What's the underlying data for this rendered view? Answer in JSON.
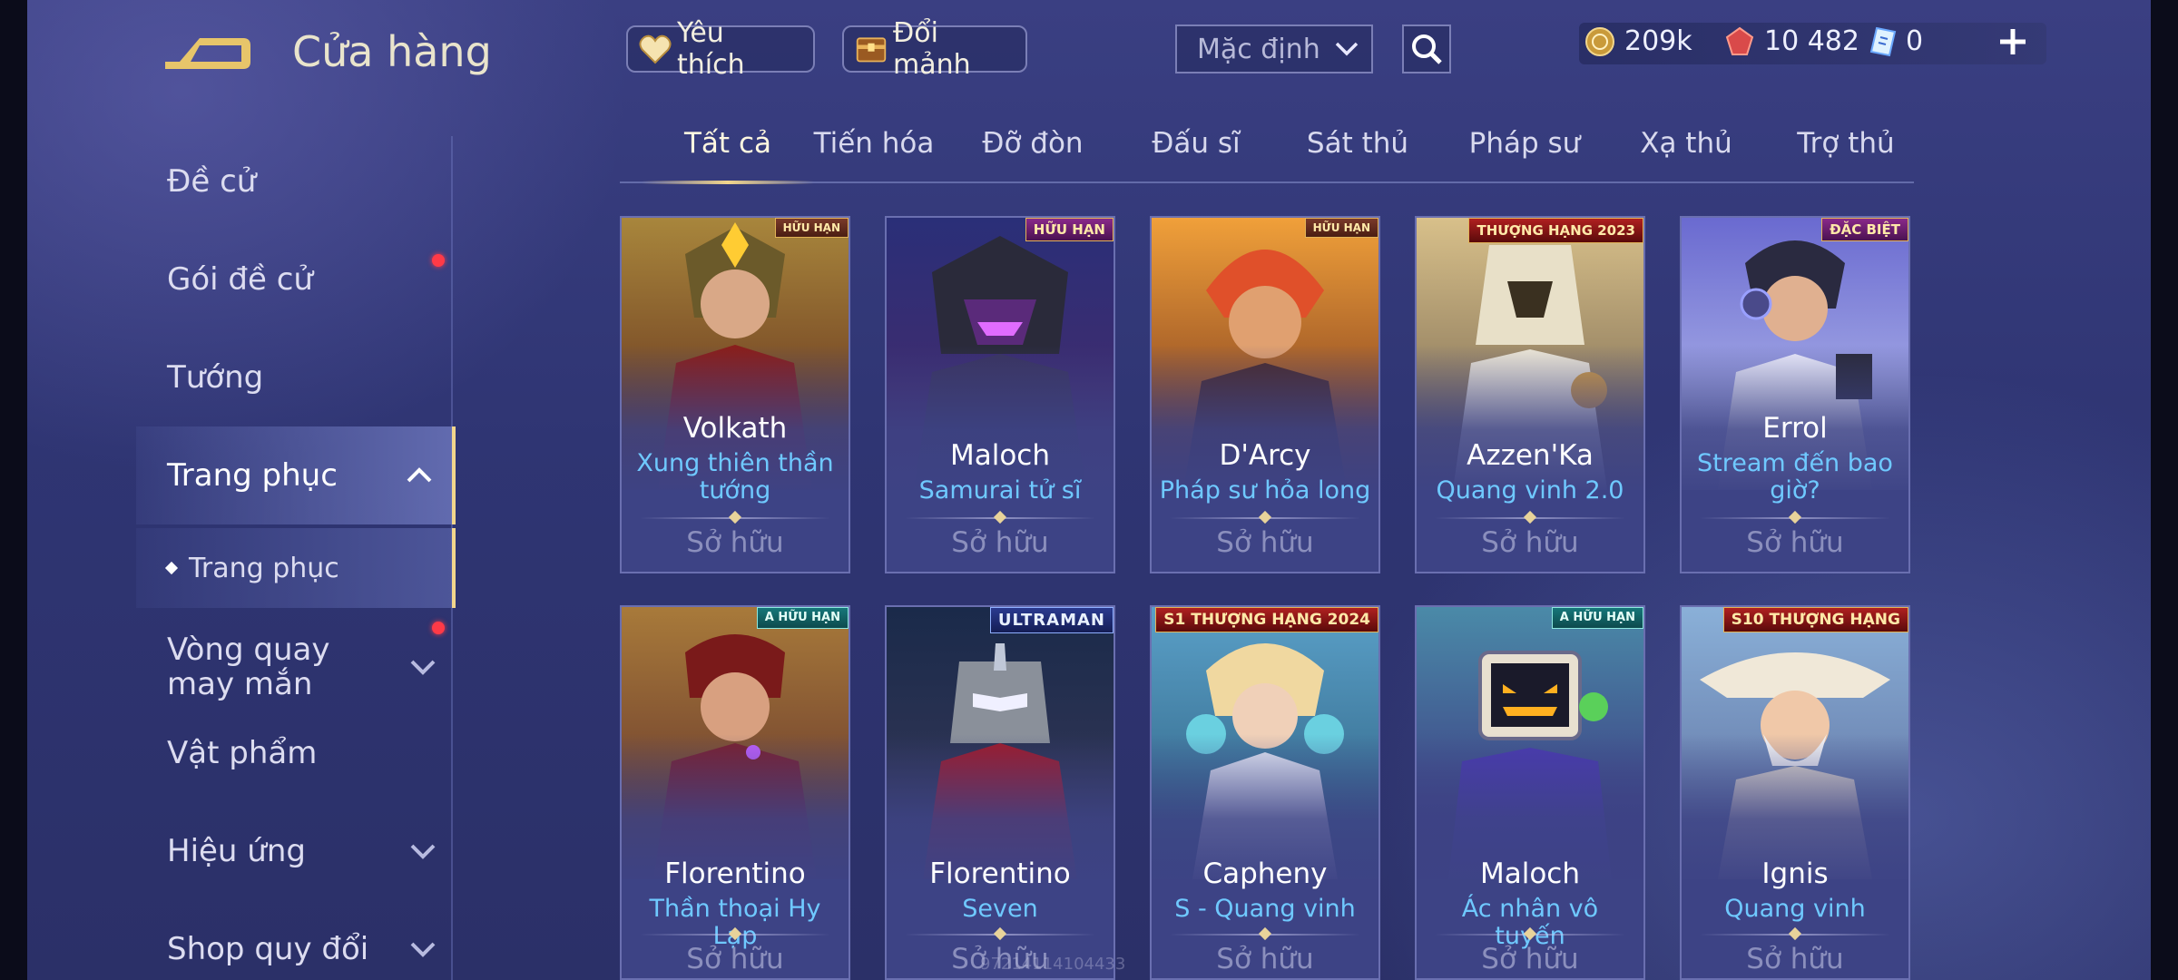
{
  "header": {
    "title": "Cửa hàng",
    "favorite_label": "Yêu thích",
    "shard_exchange_label": "Đổi mảnh",
    "sort_value": "Mặc định"
  },
  "currencies": {
    "gold": "209k",
    "gems": "10 482",
    "vouchers": "0"
  },
  "sidebar": {
    "items": [
      {
        "label": "Đề cử"
      },
      {
        "label": "Gói đề cử"
      },
      {
        "label": "Tướng"
      },
      {
        "label": "Trang phục"
      },
      {
        "label": "Trang phục"
      },
      {
        "label": "Vòng quay may mắn"
      },
      {
        "label": "Vật phẩm"
      },
      {
        "label": "Hiệu ứng"
      },
      {
        "label": "Shop quy đổi"
      }
    ]
  },
  "tabs": [
    "Tất cả",
    "Tiến hóa",
    "Đỡ đòn",
    "Đấu sĩ",
    "Sát thủ",
    "Pháp sư",
    "Xạ thủ",
    "Trợ thủ"
  ],
  "cards": [
    {
      "hero": "Volkath",
      "skin": "Xung thiên thần tướng",
      "status": "Sở hữu",
      "badge": "HỮU HẠN"
    },
    {
      "hero": "Maloch",
      "skin": "Samurai tử sĩ",
      "status": "Sở hữu",
      "badge": "HỮU HẠN"
    },
    {
      "hero": "D'Arcy",
      "skin": "Pháp sư hỏa long",
      "status": "Sở hữu",
      "badge": "HỮU HẠN"
    },
    {
      "hero": "Azzen'Ka",
      "skin": "Quang vinh 2.0",
      "status": "Sở hữu",
      "badge": "THƯỢNG HẠNG 2023"
    },
    {
      "hero": "Errol",
      "skin": "Stream đến bao giờ?",
      "status": "Sở hữu",
      "badge": "ĐẶC BIỆT"
    },
    {
      "hero": "Florentino",
      "skin": "Thần thoại Hy Lạp",
      "status": "Sở hữu",
      "badge": "A HỮU HẠN"
    },
    {
      "hero": "Florentino",
      "skin": "Seven",
      "status": "Sở hữu",
      "badge": "ULTRAMAN"
    },
    {
      "hero": "Capheny",
      "skin": "S - Quang vinh",
      "status": "Sở hữu",
      "badge": "S1 THƯỢNG HẠNG 2024"
    },
    {
      "hero": "Maloch",
      "skin": "Ác nhân vô tuyến",
      "status": "Sở hữu",
      "badge": "A HỮU HẠN"
    },
    {
      "hero": "Ignis",
      "skin": "Quang vinh",
      "status": "Sở hữu",
      "badge": "S10 THƯỢNG HẠNG"
    }
  ],
  "watermark": "97214114104433",
  "colors": {
    "accent_gold": "#f2d68c",
    "skin_name_blue": "#6fc9ff",
    "notification_red": "#ff3a47"
  }
}
